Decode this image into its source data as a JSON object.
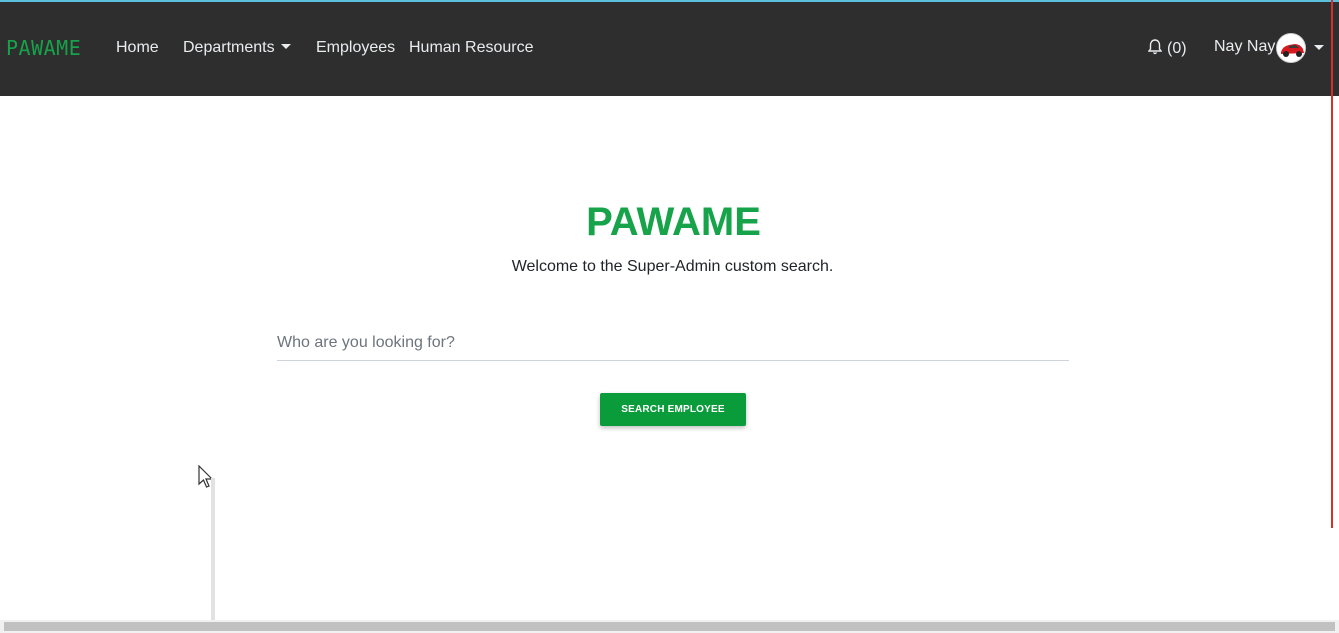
{
  "navbar": {
    "brand": "PAWAME",
    "links": {
      "home": "Home",
      "departments": "Departments",
      "employees": "Employees",
      "human_resource": "Human Resource"
    },
    "notifications": "(0)",
    "user_name": "Nay Nay"
  },
  "main": {
    "title": "PAWAME",
    "welcome": "Welcome to the Super-Admin custom search.",
    "search_placeholder": "Who are you looking for?",
    "search_value": "",
    "search_button": "SEARCH EMPLOYEE"
  },
  "colors": {
    "brand_green": "#16a34a",
    "button_green": "#0a9b3a",
    "navbar_bg": "#2e2e2e"
  }
}
